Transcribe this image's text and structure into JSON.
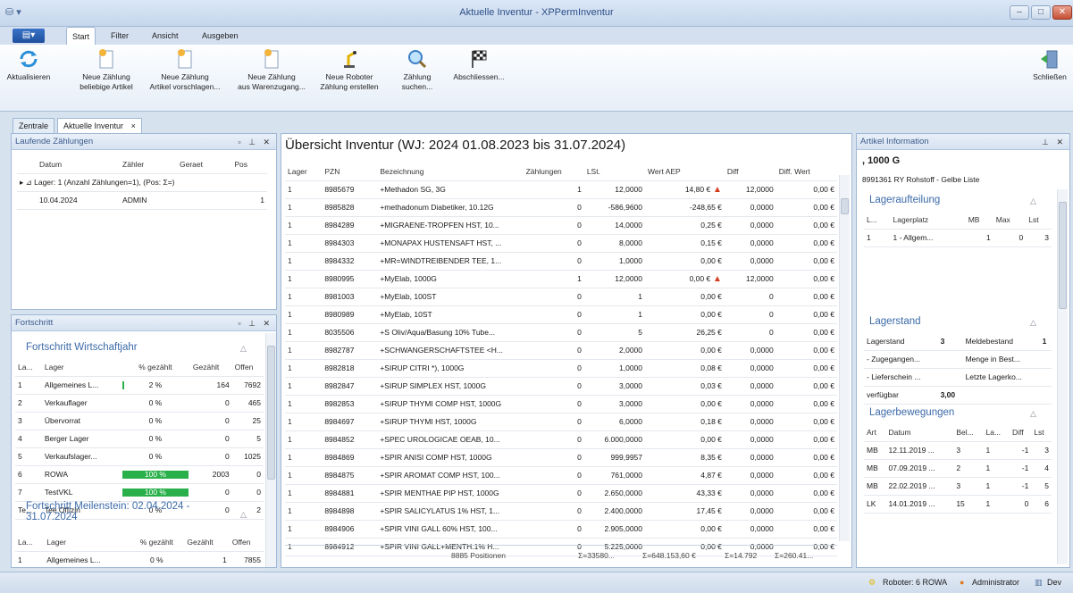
{
  "window": {
    "title": "Aktuelle Inventur - XPPermInventur",
    "min": "–",
    "max": "□",
    "close": "✕"
  },
  "ribbon_tabs": [
    "Start",
    "Filter",
    "Ansicht",
    "Ausgeben"
  ],
  "file_menu": "▤▾",
  "ribbon": {
    "refresh": [
      "Aktualisieren",
      ""
    ],
    "new_any": [
      "Neue Zählung",
      "beliebige Artikel"
    ],
    "new_suggest": [
      "Neue Zählung",
      "Artikel vorschlagen..."
    ],
    "new_incoming": [
      "Neue Zählung",
      "aus Warenzugang..."
    ],
    "new_robot": [
      "Neue Roboter",
      "Zählung erstellen"
    ],
    "search": [
      "Zählung",
      "suchen..."
    ],
    "finish": [
      "Abschliessen...",
      ""
    ],
    "close": [
      "Schließen",
      ""
    ]
  },
  "doc_tabs": {
    "zentrale": "Zentrale",
    "aktuelle": "Aktuelle Inventur",
    "close": "×"
  },
  "laufende": {
    "title": "Laufende Zählungen",
    "headers": [
      "Datum",
      "Zähler",
      "Geraet",
      "Pos"
    ],
    "group": "▸  ⊿ Lager: 1 (Anzahl Zählungen=1), (Pos: Σ=)",
    "row": [
      "10.04.2024",
      "ADMIN",
      "",
      "1"
    ]
  },
  "fortschritt": {
    "title": "Fortschritt",
    "wj_title": "Fortschritt Wirtschaftjahr",
    "headers": [
      "La...",
      "Lager",
      "% gezählt",
      "Gezählt",
      "Offen"
    ],
    "rows": [
      [
        "1",
        "Allgemeines L...",
        "2 %",
        "164",
        "7692",
        0.02
      ],
      [
        "2",
        "Verkauflager",
        "0 %",
        "0",
        "465",
        0
      ],
      [
        "3",
        "Übervorrat",
        "0 %",
        "0",
        "25",
        0
      ],
      [
        "4",
        "Berger Lager",
        "0 %",
        "0",
        "5",
        0
      ],
      [
        "5",
        "Verkaufslager...",
        "0 %",
        "0",
        "1025",
        0
      ],
      [
        "6",
        "ROWA",
        "100 %",
        "2003",
        "0",
        1
      ],
      [
        "7",
        "TestVKL",
        "100 %",
        "0",
        "0",
        1
      ],
      [
        "Te...",
        "Tee Offizin",
        "0 %",
        "0",
        "2",
        0
      ]
    ],
    "ms_title": "Fortschritt Meilenstein: 02.04.2024 - 31.07.2024",
    "ms_headers": [
      "La...",
      "Lager",
      "% gezählt",
      "Gezählt",
      "Offen"
    ],
    "ms_rows": [
      [
        "1",
        "Allgemeines L...",
        "0 %",
        "1",
        "7855"
      ]
    ]
  },
  "overview": {
    "title": "Übersicht Inventur (WJ: 2024 01.08.2023 bis 31.07.2024)",
    "headers": [
      "Lager",
      "PZN",
      "Bezeichnung",
      "Zählungen",
      "LSt.",
      "Wert AEP",
      "Diff",
      "Diff. Wert"
    ],
    "rows": [
      [
        "1",
        "8985679",
        "+Methadon SG, 3G",
        "1",
        "12,0000",
        "14,80 €",
        "12,0000",
        "0,00 €",
        true
      ],
      [
        "1",
        "8985828",
        "+methadonum Diabetiker, 10.12G",
        "0",
        "-586,9600",
        "-248,65 €",
        "0,0000",
        "0,00 €",
        false
      ],
      [
        "1",
        "8984289",
        "+MIGRAENE-TROPFEN HST, 10...",
        "0",
        "14,0000",
        "0,25 €",
        "0,0000",
        "0,00 €",
        false
      ],
      [
        "1",
        "8984303",
        "+MONAPAX HUSTENSAFT HST, ...",
        "0",
        "8,0000",
        "0,15 €",
        "0,0000",
        "0,00 €",
        false
      ],
      [
        "1",
        "8984332",
        "+MR=WINDTREIBENDER TEE, 1...",
        "0",
        "1,0000",
        "0,00 €",
        "0,0000",
        "0,00 €",
        false
      ],
      [
        "1",
        "8980995",
        "+MyElab, 1000G",
        "1",
        "12,0000",
        "0,00 €",
        "12,0000",
        "0,00 €",
        true
      ],
      [
        "1",
        "8981003",
        "+MyElab, 100ST",
        "0",
        "1",
        "0,00 €",
        "0",
        "0,00 €",
        false
      ],
      [
        "1",
        "8980989",
        "+MyElab, 10ST",
        "0",
        "1",
        "0,00 €",
        "0",
        "0,00 €",
        false
      ],
      [
        "1",
        "8035506",
        "+S Oliv/Aqua/Basung 10% Tube...",
        "0",
        "5",
        "26,25 €",
        "0",
        "0,00 €",
        false
      ],
      [
        "1",
        "8982787",
        "+SCHWANGERSCHAFTSTEE <H...",
        "0",
        "2,0000",
        "0,00 €",
        "0,0000",
        "0,00 €",
        false
      ],
      [
        "1",
        "8982818",
        "+SIRUP CITRI *), 1000G",
        "0",
        "1,0000",
        "0,08 €",
        "0,0000",
        "0,00 €",
        false
      ],
      [
        "1",
        "8982847",
        "+SIRUP SIMPLEX HST, 1000G",
        "0",
        "3,0000",
        "0,03 €",
        "0,0000",
        "0,00 €",
        false
      ],
      [
        "1",
        "8982853",
        "+SIRUP THYMI COMP HST, 1000G",
        "0",
        "3,0000",
        "0,00 €",
        "0,0000",
        "0,00 €",
        false
      ],
      [
        "1",
        "8984697",
        "+SIRUP THYMI HST, 1000G",
        "0",
        "6,0000",
        "0,18 €",
        "0,0000",
        "0,00 €",
        false
      ],
      [
        "1",
        "8984852",
        "+SPEC UROLOGICAE OEAB, 10...",
        "0",
        "6.000,0000",
        "0,00 €",
        "0,0000",
        "0,00 €",
        false
      ],
      [
        "1",
        "8984869",
        "+SPIR ANISI COMP HST, 1000G",
        "0",
        "999,9957",
        "8,35 €",
        "0,0000",
        "0,00 €",
        false
      ],
      [
        "1",
        "8984875",
        "+SPIR AROMAT COMP HST, 100...",
        "0",
        "761,0000",
        "4,87 €",
        "0,0000",
        "0,00 €",
        false
      ],
      [
        "1",
        "8984881",
        "+SPIR MENTHAE PIP HST, 1000G",
        "0",
        "2.650,0000",
        "43,33 €",
        "0,0000",
        "0,00 €",
        false
      ],
      [
        "1",
        "8984898",
        "+SPIR SALICYLATUS 1% HST, 1...",
        "0",
        "2.400,0000",
        "17,45 €",
        "0,0000",
        "0,00 €",
        false
      ],
      [
        "1",
        "8984906",
        "+SPIR VINI GALL 60% HST, 100...",
        "0",
        "2.905,0000",
        "0,00 €",
        "0,0000",
        "0,00 €",
        false
      ],
      [
        "1",
        "8984912",
        "+SPIR VINI GALL+MENTH.1% H...",
        "0",
        "5.225,0000",
        "0,00 €",
        "0,0000",
        "0,00 €",
        false
      ]
    ],
    "footer": {
      "positions": "8885 Positionen",
      "lst": "Σ=33580...",
      "wert": "Σ=648.153,60 €",
      "diff": "Σ=14.792",
      "diffwert": "Σ=260.41..."
    }
  },
  "artikel": {
    "title": "Artikel Information",
    "name": ", 1000 G",
    "sub": "8991361  RY Rohstoff - Gelbe Liste",
    "lageraufteilung": "Lageraufteilung",
    "la_headers": [
      "L...",
      "Lagerplatz",
      "MB",
      "Max",
      "Lst"
    ],
    "la_row": [
      "1",
      "1 - Allgem...",
      "1",
      "0",
      "3"
    ],
    "lagerstand": "Lagerstand",
    "ls": {
      "lagerstand_l": "Lagerstand",
      "lagerstand_v": "3",
      "melde_l": "Meldebestand",
      "melde_v": "1",
      "zug_l": "- Zugegangen...",
      "menge_l": "Menge in Best...",
      "lief_l": "- Lieferschein ...",
      "letzte_l": "Letzte Lagerko...",
      "verf_l": "verfügbar",
      "verf_v": "3,00"
    },
    "bewegungen": "Lagerbewegungen",
    "bw_headers": [
      "Art",
      "Datum",
      "Bel...",
      "La...",
      "Diff",
      "Lst"
    ],
    "bw_rows": [
      [
        "MB",
        "12.11.2019 ...",
        "3",
        "1",
        "-1",
        "3"
      ],
      [
        "MB",
        "07.09.2019 ...",
        "2",
        "1",
        "-1",
        "4"
      ],
      [
        "MB",
        "22.02.2019 ...",
        "3",
        "1",
        "-1",
        "5"
      ],
      [
        "LK",
        "14.01.2019 ...",
        "15",
        "1",
        "0",
        "6"
      ]
    ]
  },
  "status": {
    "robot": "Roboter: 6 ROWA",
    "user": "Administrator",
    "env": "Dev"
  },
  "colors": {
    "accent": "#3b6aa8",
    "progress": "#29b04a",
    "arrow_up": "#d43c1e"
  }
}
